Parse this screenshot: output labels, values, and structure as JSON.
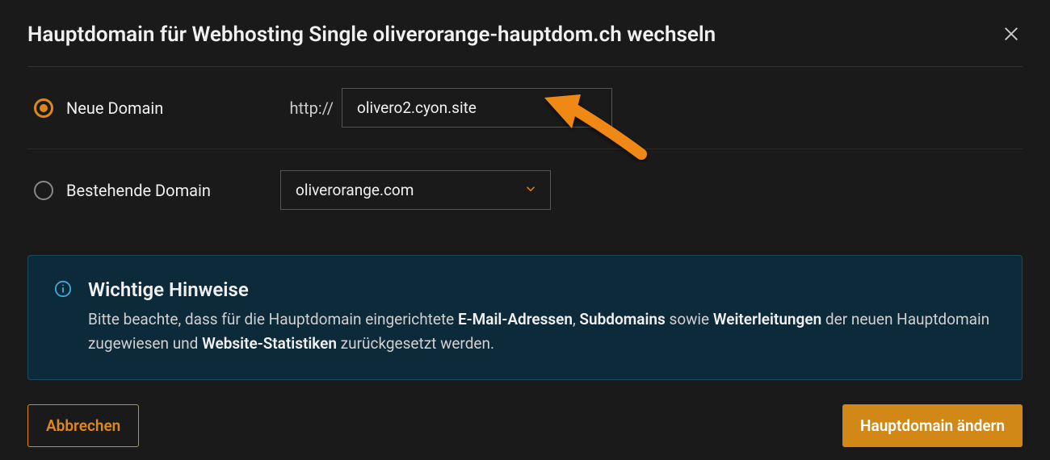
{
  "header": {
    "title": "Hauptdomain für Webhosting Single oliverorange-hauptdom.ch wechseln"
  },
  "options": {
    "new": {
      "label": "Neue Domain",
      "prefix": "http://",
      "value": "olivero2.cyon.site"
    },
    "existing": {
      "label": "Bestehende Domain",
      "selected": "oliverorange.com"
    }
  },
  "info": {
    "title": "Wichtige Hinweise",
    "body_pre": "Bitte beachte, dass für die Hauptdomain eingerichtete ",
    "b1": "E-Mail-Adressen",
    "sep1": ", ",
    "b2": "Subdomains",
    "sep2": " sowie ",
    "b3": "Weiterleitungen",
    "mid": " der neuen Hauptdomain zugewiesen und ",
    "b4": "Website-Statistiken",
    "end": " zurückgesetzt werden."
  },
  "footer": {
    "cancel": "Abbrechen",
    "submit": "Hauptdomain ändern"
  }
}
